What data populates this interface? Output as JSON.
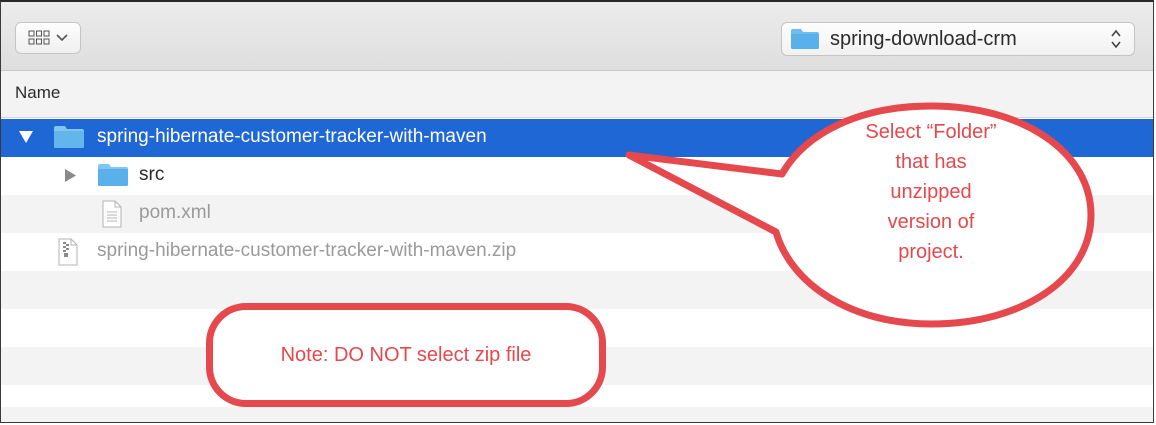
{
  "window": {
    "location_label": "spring-download-crm"
  },
  "columns": {
    "name": "Name"
  },
  "rows": [
    {
      "name": "spring-hibernate-customer-tracker-with-maven",
      "kind": "folder",
      "expanded": true,
      "selected": true
    },
    {
      "name": "src",
      "kind": "folder",
      "expanded": false,
      "selected": false
    },
    {
      "name": "pom.xml",
      "kind": "file",
      "selected": false
    },
    {
      "name": "spring-hibernate-customer-tracker-with-maven.zip",
      "kind": "zip",
      "selected": false
    }
  ],
  "callouts": {
    "folder_note": [
      "Select “Folder”",
      "that has",
      "unzipped",
      "version of",
      "project."
    ],
    "zip_note": "Note: DO NOT select zip file"
  },
  "colors": {
    "selection": "#1e67d4",
    "folder": "#5ab0ea",
    "callout_stroke": "#e5484d"
  },
  "icons": [
    "view-options-icon",
    "chevron-down-icon",
    "folder-icon",
    "updown-arrows-icon",
    "disclosure-triangle-icon",
    "document-icon",
    "zip-icon"
  ]
}
